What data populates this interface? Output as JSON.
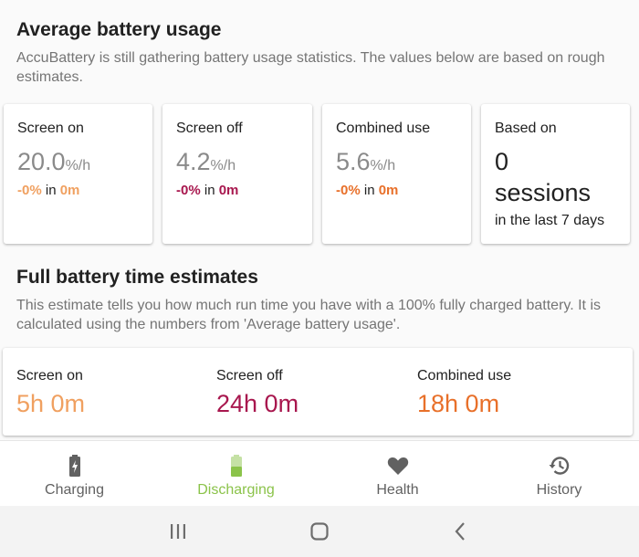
{
  "avg": {
    "title": "Average battery usage",
    "description": "AccuBattery is still gathering battery usage statistics. The values below are based on rough estimates.",
    "cards": [
      {
        "label": "Screen on",
        "value": "20.0",
        "unit": "%/h",
        "delta_pct": "-0%",
        "delta_in": "in",
        "delta_time": "0m",
        "accent": "#f0a060"
      },
      {
        "label": "Screen off",
        "value": "4.2",
        "unit": "%/h",
        "delta_pct": "-0%",
        "delta_in": "in",
        "delta_time": "0m",
        "accent": "#a8174e"
      },
      {
        "label": "Combined use",
        "value": "5.6",
        "unit": "%/h",
        "delta_pct": "-0%",
        "delta_in": "in",
        "delta_time": "0m",
        "accent": "#e8702a"
      }
    ],
    "sessions": {
      "label": "Based on",
      "count": "0",
      "word": "sessions",
      "period": "in the last 7 days"
    }
  },
  "full": {
    "title": "Full battery time estimates",
    "description": "This estimate tells you how much run time you have with a 100% fully charged battery. It is calculated using the numbers from 'Average battery usage'.",
    "items": [
      {
        "label": "Screen on",
        "value": "5h 0m",
        "color": "#f0a060"
      },
      {
        "label": "Screen off",
        "value": "24h 0m",
        "color": "#a8174e"
      },
      {
        "label": "Combined use",
        "value": "18h 0m",
        "color": "#e8702a"
      }
    ]
  },
  "nav": {
    "active": "Discharging",
    "items": [
      {
        "label": "Charging",
        "icon": "battery-charging-icon"
      },
      {
        "label": "Discharging",
        "icon": "battery-icon"
      },
      {
        "label": "Health",
        "icon": "heart-icon"
      },
      {
        "label": "History",
        "icon": "history-icon"
      }
    ],
    "active_color": "#8bc34a",
    "inactive_color": "#616161"
  },
  "system_nav": [
    "recents-icon",
    "home-icon",
    "back-icon"
  ]
}
